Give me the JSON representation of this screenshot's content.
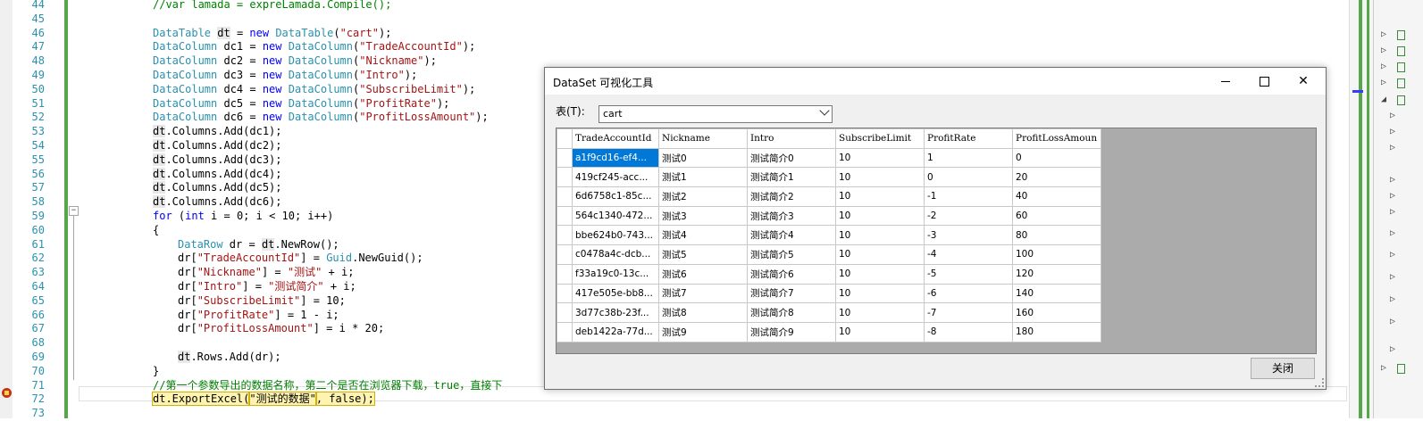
{
  "editor": {
    "line_numbers": [
      "44",
      "45",
      "46",
      "47",
      "48",
      "49",
      "50",
      "51",
      "52",
      "53",
      "54",
      "55",
      "56",
      "57",
      "58",
      "59",
      "60",
      "61",
      "62",
      "63",
      "64",
      "65",
      "66",
      "67",
      "68",
      "69",
      "70",
      "71",
      "72",
      "73"
    ],
    "lines": [
      {
        "indent": 0,
        "segs": [
          {
            "t": "//var lamada = expreLamada.Compile();",
            "c": "cm"
          }
        ]
      },
      {
        "indent": 0,
        "segs": []
      },
      {
        "indent": 0,
        "segs": [
          {
            "t": "DataTable",
            "c": "ty"
          },
          {
            "t": " "
          },
          {
            "t": "dt",
            "c": "hl"
          },
          {
            "t": " = "
          },
          {
            "t": "new",
            "c": "kw"
          },
          {
            "t": " "
          },
          {
            "t": "DataTable",
            "c": "ty"
          },
          {
            "t": "("
          },
          {
            "t": "\"cart\"",
            "c": "str"
          },
          {
            "t": ");"
          }
        ]
      },
      {
        "indent": 0,
        "segs": [
          {
            "t": "DataColumn",
            "c": "ty"
          },
          {
            "t": " dc1 = "
          },
          {
            "t": "new",
            "c": "kw"
          },
          {
            "t": " "
          },
          {
            "t": "DataColumn",
            "c": "ty"
          },
          {
            "t": "("
          },
          {
            "t": "\"TradeAccountId\"",
            "c": "str"
          },
          {
            "t": ");"
          }
        ]
      },
      {
        "indent": 0,
        "segs": [
          {
            "t": "DataColumn",
            "c": "ty"
          },
          {
            "t": " dc2 = "
          },
          {
            "t": "new",
            "c": "kw"
          },
          {
            "t": " "
          },
          {
            "t": "DataColumn",
            "c": "ty"
          },
          {
            "t": "("
          },
          {
            "t": "\"Nickname\"",
            "c": "str"
          },
          {
            "t": ");"
          }
        ]
      },
      {
        "indent": 0,
        "segs": [
          {
            "t": "DataColumn",
            "c": "ty"
          },
          {
            "t": " dc3 = "
          },
          {
            "t": "new",
            "c": "kw"
          },
          {
            "t": " "
          },
          {
            "t": "DataColumn",
            "c": "ty"
          },
          {
            "t": "("
          },
          {
            "t": "\"Intro\"",
            "c": "str"
          },
          {
            "t": ");"
          }
        ]
      },
      {
        "indent": 0,
        "segs": [
          {
            "t": "DataColumn",
            "c": "ty"
          },
          {
            "t": " dc4 = "
          },
          {
            "t": "new",
            "c": "kw"
          },
          {
            "t": " "
          },
          {
            "t": "DataColumn",
            "c": "ty"
          },
          {
            "t": "("
          },
          {
            "t": "\"SubscribeLimit\"",
            "c": "str"
          },
          {
            "t": ");"
          }
        ]
      },
      {
        "indent": 0,
        "segs": [
          {
            "t": "DataColumn",
            "c": "ty"
          },
          {
            "t": " dc5 = "
          },
          {
            "t": "new",
            "c": "kw"
          },
          {
            "t": " "
          },
          {
            "t": "DataColumn",
            "c": "ty"
          },
          {
            "t": "("
          },
          {
            "t": "\"ProfitRate\"",
            "c": "str"
          },
          {
            "t": ");"
          }
        ]
      },
      {
        "indent": 0,
        "segs": [
          {
            "t": "DataColumn",
            "c": "ty"
          },
          {
            "t": " dc6 = "
          },
          {
            "t": "new",
            "c": "kw"
          },
          {
            "t": " "
          },
          {
            "t": "DataColumn",
            "c": "ty"
          },
          {
            "t": "("
          },
          {
            "t": "\"ProfitLossAmount\"",
            "c": "str"
          },
          {
            "t": ");"
          }
        ]
      },
      {
        "indent": 0,
        "segs": [
          {
            "t": "dt",
            "c": "hl"
          },
          {
            "t": ".Columns.Add(dc1);"
          }
        ]
      },
      {
        "indent": 0,
        "segs": [
          {
            "t": "dt",
            "c": "hl"
          },
          {
            "t": ".Columns.Add(dc2);"
          }
        ]
      },
      {
        "indent": 0,
        "segs": [
          {
            "t": "dt",
            "c": "hl"
          },
          {
            "t": ".Columns.Add(dc3);"
          }
        ]
      },
      {
        "indent": 0,
        "segs": [
          {
            "t": "dt",
            "c": "hl"
          },
          {
            "t": ".Columns.Add(dc4);"
          }
        ]
      },
      {
        "indent": 0,
        "segs": [
          {
            "t": "dt",
            "c": "hl"
          },
          {
            "t": ".Columns.Add(dc5);"
          }
        ]
      },
      {
        "indent": 0,
        "segs": [
          {
            "t": "dt",
            "c": "hl"
          },
          {
            "t": ".Columns.Add(dc6);"
          }
        ]
      },
      {
        "indent": 0,
        "segs": [
          {
            "t": "for",
            "c": "kw"
          },
          {
            "t": " ("
          },
          {
            "t": "int",
            "c": "kw"
          },
          {
            "t": " i = 0; i < 10; i++)"
          }
        ]
      },
      {
        "indent": 0,
        "segs": [
          {
            "t": "{"
          }
        ]
      },
      {
        "indent": 1,
        "segs": [
          {
            "t": "DataRow",
            "c": "ty"
          },
          {
            "t": " dr = "
          },
          {
            "t": "dt",
            "c": "hl"
          },
          {
            "t": ".NewRow();"
          }
        ]
      },
      {
        "indent": 1,
        "segs": [
          {
            "t": "dr["
          },
          {
            "t": "\"TradeAccountId\"",
            "c": "str"
          },
          {
            "t": "] = "
          },
          {
            "t": "Guid",
            "c": "ty"
          },
          {
            "t": ".NewGuid();"
          }
        ]
      },
      {
        "indent": 1,
        "segs": [
          {
            "t": "dr["
          },
          {
            "t": "\"Nickname\"",
            "c": "str"
          },
          {
            "t": "] = "
          },
          {
            "t": "\"测试\"",
            "c": "str"
          },
          {
            "t": " + i;"
          }
        ]
      },
      {
        "indent": 1,
        "segs": [
          {
            "t": "dr["
          },
          {
            "t": "\"Intro\"",
            "c": "str"
          },
          {
            "t": "] = "
          },
          {
            "t": "\"测试简介\"",
            "c": "str"
          },
          {
            "t": " + i;"
          }
        ]
      },
      {
        "indent": 1,
        "segs": [
          {
            "t": "dr["
          },
          {
            "t": "\"SubscribeLimit\"",
            "c": "str"
          },
          {
            "t": "] = 10;"
          }
        ]
      },
      {
        "indent": 1,
        "segs": [
          {
            "t": "dr["
          },
          {
            "t": "\"ProfitRate\"",
            "c": "str"
          },
          {
            "t": "] = 1 - i;"
          }
        ]
      },
      {
        "indent": 1,
        "segs": [
          {
            "t": "dr["
          },
          {
            "t": "\"ProfitLossAmount\"",
            "c": "str"
          },
          {
            "t": "] = i * 20;"
          }
        ]
      },
      {
        "indent": 1,
        "segs": []
      },
      {
        "indent": 1,
        "segs": [
          {
            "t": "dt",
            "c": "hl"
          },
          {
            "t": ".Rows.Add(dr);"
          }
        ]
      },
      {
        "indent": 0,
        "segs": [
          {
            "t": "}"
          }
        ]
      },
      {
        "indent": 0,
        "segs": [
          {
            "t": "//第一个参数导出的数据名称，第二个是否在浏览器下载，true，直接下",
            "c": "cm"
          }
        ]
      },
      {
        "indent": 0,
        "segs": [
          {
            "t": "dt.ExportExcel(",
            "c": "exec"
          },
          {
            "t": "\"测试的数据\"",
            "c": "exec"
          },
          {
            "t": ", false);",
            "c": "exec"
          }
        ]
      },
      {
        "indent": 0,
        "segs": []
      }
    ]
  },
  "dialog": {
    "title": "DataSet 可视化工具",
    "table_label": "表(T):",
    "selected_table": "cart",
    "close_button": "关闭",
    "columns": [
      "TradeAccountId",
      "Nickname",
      "Intro",
      "SubscribeLimit",
      "ProfitRate",
      "ProfitLossAmoun"
    ],
    "rows": [
      [
        "a1f9cd16-ef4...",
        "测试0",
        "测试简介0",
        "10",
        "1",
        "0"
      ],
      [
        "419cf245-acc...",
        "测试1",
        "测试简介1",
        "10",
        "0",
        "20"
      ],
      [
        "6d6758c1-85c...",
        "测试2",
        "测试简介2",
        "10",
        "-1",
        "40"
      ],
      [
        "564c1340-472...",
        "测试3",
        "测试简介3",
        "10",
        "-2",
        "60"
      ],
      [
        "bbe624b0-743...",
        "测试4",
        "测试简介4",
        "10",
        "-3",
        "80"
      ],
      [
        "c0478a4c-dcb...",
        "测试5",
        "测试简介5",
        "10",
        "-4",
        "100"
      ],
      [
        "f33a19c0-13c...",
        "测试6",
        "测试简介6",
        "10",
        "-5",
        "120"
      ],
      [
        "417e505e-bb8...",
        "测试7",
        "测试简介7",
        "10",
        "-6",
        "140"
      ],
      [
        "3d77c38b-23f...",
        "测试8",
        "测试简介8",
        "10",
        "-7",
        "160"
      ],
      [
        "deb1422a-77d...",
        "测试9",
        "测试简介9",
        "10",
        "-8",
        "180"
      ]
    ]
  }
}
